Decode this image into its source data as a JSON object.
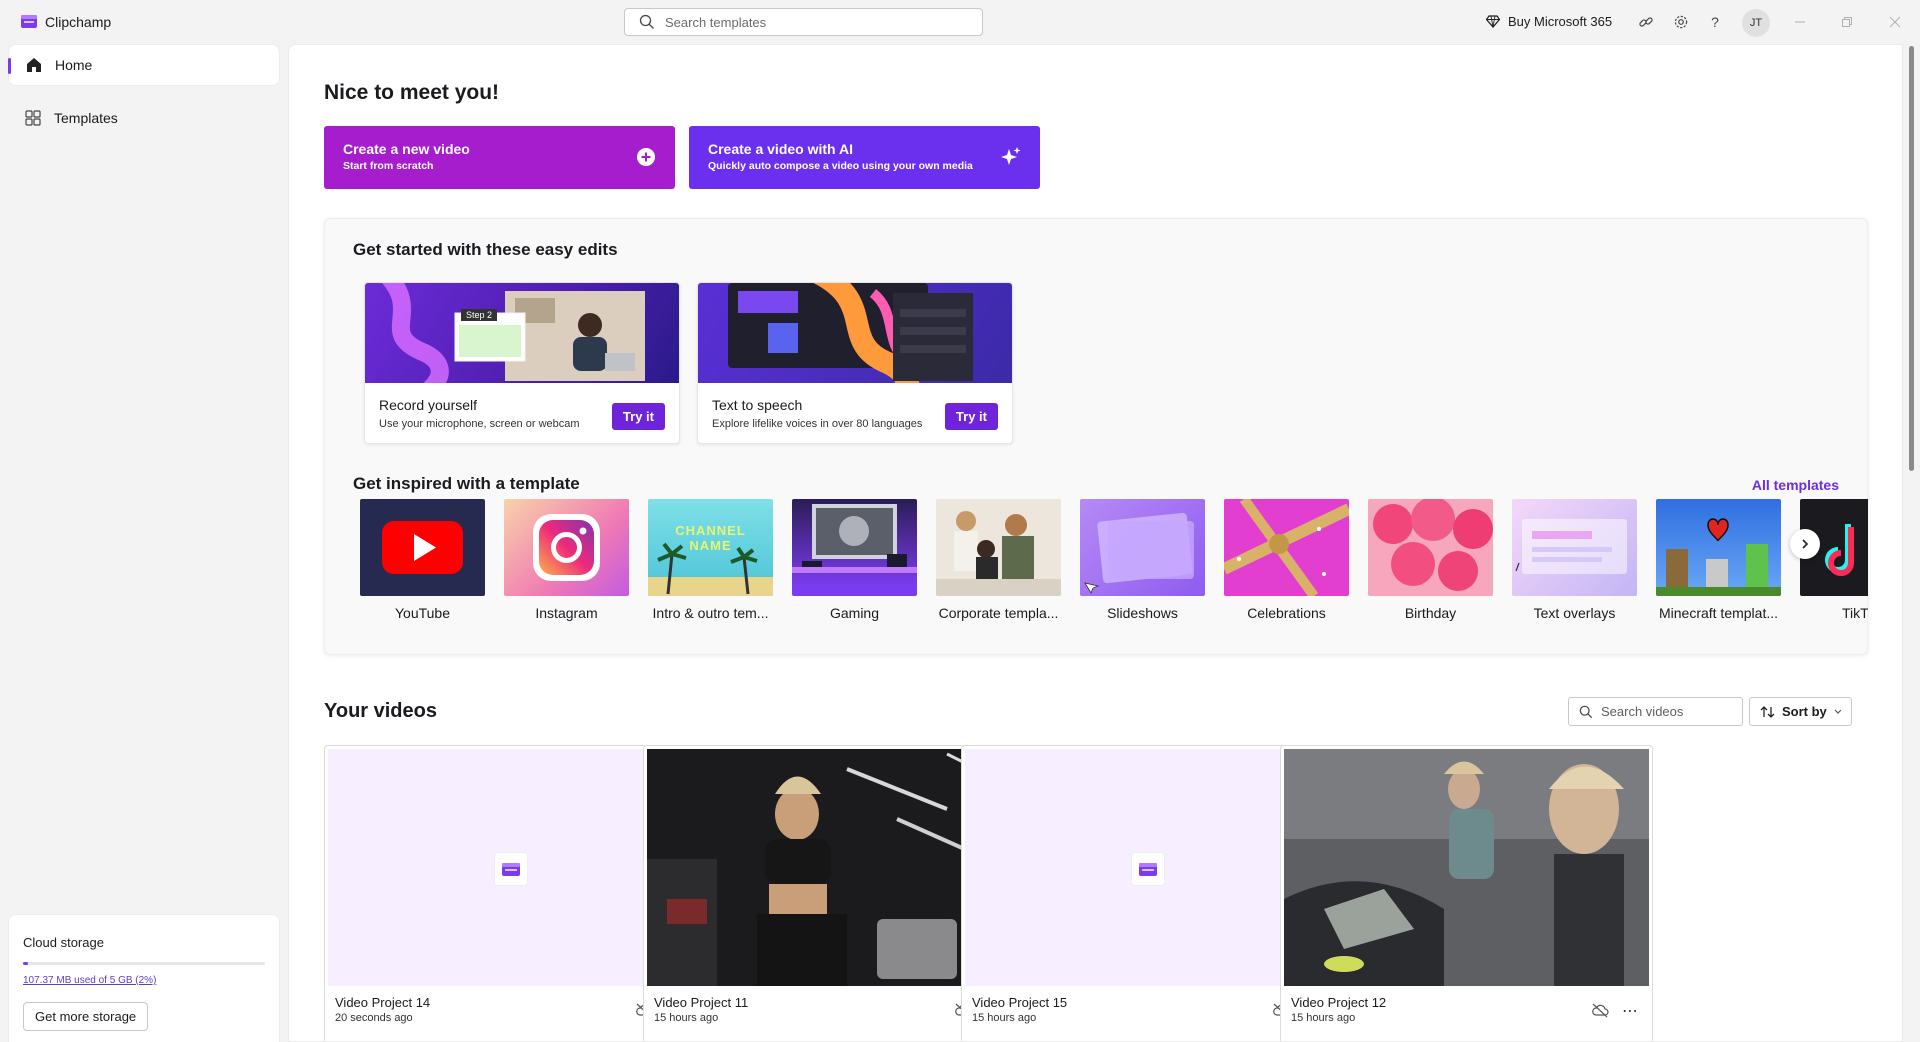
{
  "titlebar": {
    "app_name": "Clipchamp",
    "search_placeholder": "Search templates",
    "buy_label": "Buy Microsoft 365",
    "help_label": "?",
    "avatar_initials": "JT"
  },
  "sidebar": {
    "items": [
      {
        "label": "Home",
        "icon": "home-icon",
        "active": true
      },
      {
        "label": "Templates",
        "icon": "templates-icon",
        "active": false
      }
    ],
    "storage": {
      "title": "Cloud storage",
      "usage_text": "107.37 MB used of 5 GB (2%)",
      "usage_fraction": 0.02,
      "button_label": "Get more storage"
    }
  },
  "main": {
    "greeting": "Nice to meet you!",
    "cta_new": {
      "title": "Create a new video",
      "subtitle": "Start from scratch",
      "icon": "plus-circle-icon"
    },
    "cta_ai": {
      "title": "Create a video with AI",
      "subtitle": "Quickly auto compose a video using your own media",
      "icon": "sparkle-icon"
    },
    "easy_edits": {
      "heading": "Get started with these easy edits",
      "cards": [
        {
          "title": "Record yourself",
          "subtitle": "Use your microphone, screen or webcam",
          "button": "Try it",
          "thumb_badge": "Step 2"
        },
        {
          "title": "Text to speech",
          "subtitle": "Explore lifelike voices in over 80 languages",
          "button": "Try it"
        }
      ]
    },
    "templates": {
      "heading": "Get inspired with a template",
      "all_link": "All templates",
      "items": [
        {
          "label": "YouTube"
        },
        {
          "label": "Instagram"
        },
        {
          "label": "Intro & outro tem..."
        },
        {
          "label": "Gaming"
        },
        {
          "label": "Corporate templa..."
        },
        {
          "label": "Slideshows"
        },
        {
          "label": "Celebrations"
        },
        {
          "label": "Birthday"
        },
        {
          "label": "Text overlays"
        },
        {
          "label": "Minecraft templat..."
        },
        {
          "label": "TikT"
        }
      ],
      "intro_thumb_text": "CHANNEL NAME"
    },
    "videos": {
      "heading": "Your videos",
      "search_placeholder": "Search videos",
      "sort_label": "Sort by",
      "items": [
        {
          "title": "Video Project 14",
          "time": "20 seconds ago",
          "thumb": "blank"
        },
        {
          "title": "Video Project 11",
          "time": "15 hours ago",
          "thumb": "gym"
        },
        {
          "title": "Video Project 15",
          "time": "15 hours ago",
          "thumb": "blank"
        },
        {
          "title": "Video Project 12",
          "time": "15 hours ago",
          "thumb": "workout"
        }
      ]
    }
  },
  "colors": {
    "accent": "#7c3aed",
    "cta_new_bg": "#a51dcc",
    "cta_ai_bg": "#6b30ee",
    "try_button": "#7024d9",
    "link": "#6d2de0"
  }
}
